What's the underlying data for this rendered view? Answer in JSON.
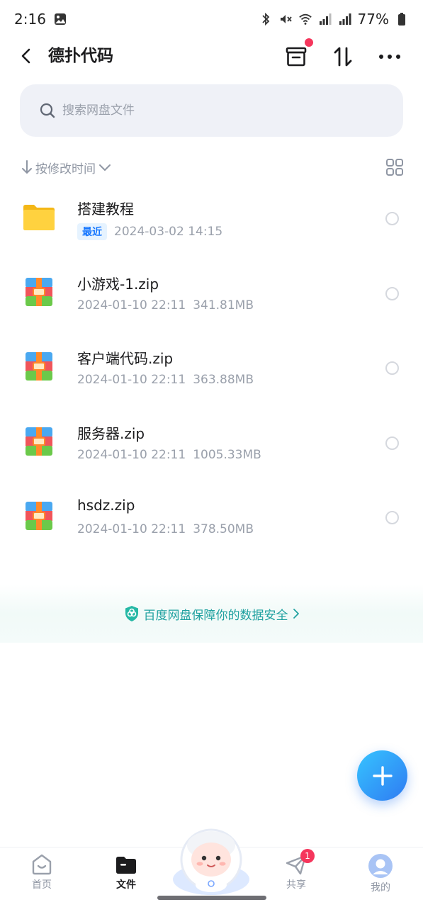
{
  "status_bar": {
    "time": "2:16",
    "battery": "77%"
  },
  "header": {
    "title": "德扑代码"
  },
  "search": {
    "placeholder": "搜索网盘文件"
  },
  "sort": {
    "label": "按修改时间"
  },
  "files": [
    {
      "name": "搭建教程",
      "type": "folder",
      "badge": "最近",
      "datetime": "2024-03-02  14:15",
      "size": ""
    },
    {
      "name": "小游戏-1.zip",
      "type": "zip",
      "badge": "",
      "datetime": "2024-01-10  22:11",
      "size": "341.81MB"
    },
    {
      "name": "客户端代码.zip",
      "type": "zip",
      "badge": "",
      "datetime": "2024-01-10  22:11",
      "size": "363.88MB"
    },
    {
      "name": "服务器.zip",
      "type": "zip",
      "badge": "",
      "datetime": "2024-01-10  22:11",
      "size": "1005.33MB"
    },
    {
      "name": "hsdz.zip",
      "type": "zip",
      "badge": "",
      "datetime": "2024-01-10  22:11",
      "size": "378.50MB"
    }
  ],
  "security_banner": {
    "text": "百度网盘保障你的数据安全"
  },
  "bottom_nav": {
    "home": "首页",
    "files": "文件",
    "share": "共享",
    "share_badge": "1",
    "mine": "我的"
  },
  "colors": {
    "accent": "#2f7bf2",
    "security_text": "#20a1a0",
    "badge_red": "#f5365c"
  }
}
